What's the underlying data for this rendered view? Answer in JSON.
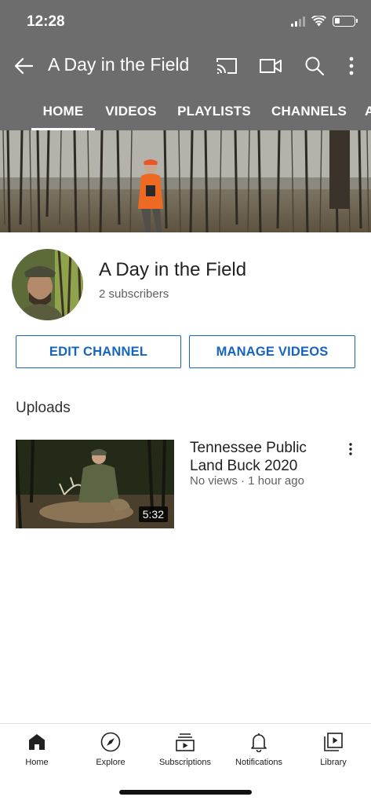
{
  "status_bar": {
    "time": "12:28"
  },
  "app_bar": {
    "title": "A Day in the Field"
  },
  "tabs": [
    {
      "label": "HOME",
      "active": true
    },
    {
      "label": "VIDEOS"
    },
    {
      "label": "PLAYLISTS"
    },
    {
      "label": "CHANNELS"
    },
    {
      "label": "A"
    }
  ],
  "channel": {
    "name": "A Day in the Field",
    "subscribers": "2 subscribers",
    "edit_label": "EDIT CHANNEL",
    "manage_label": "MANAGE VIDEOS"
  },
  "uploads": {
    "heading": "Uploads",
    "videos": [
      {
        "title": "Tennessee Public Land Buck 2020",
        "meta": "No views · 1 hour ago",
        "duration": "5:32"
      }
    ]
  },
  "bottom_nav": [
    {
      "label": "Home",
      "icon": "home-icon",
      "active": true
    },
    {
      "label": "Explore",
      "icon": "compass-icon"
    },
    {
      "label": "Subscriptions",
      "icon": "subscriptions-icon"
    },
    {
      "label": "Notifications",
      "icon": "bell-icon"
    },
    {
      "label": "Library",
      "icon": "library-icon"
    }
  ],
  "colors": {
    "header_bg": "#6d6d6d",
    "accent_blue": "#1565c0",
    "text_primary": "#212121",
    "text_secondary": "#606060"
  }
}
